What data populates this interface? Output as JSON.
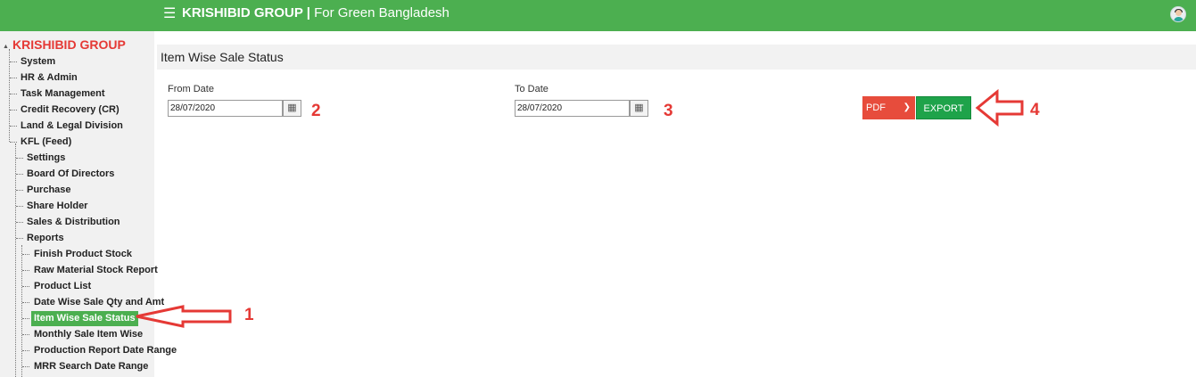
{
  "header": {
    "brand": "KRISHIBID GROUP",
    "separator": " | ",
    "tagline": "For Green Bangladesh"
  },
  "sidebar": {
    "root": "KRISHIBID GROUP",
    "items": [
      "System",
      "HR & Admin",
      "Task Management",
      "Credit Recovery (CR)",
      "Land & Legal Division",
      "KFL (Feed)",
      "Settings",
      "Board Of Directors",
      "Purchase",
      "Share Holder",
      "Sales & Distribution",
      "Reports",
      "Finish Product Stock",
      "Raw Material Stock Report",
      "Product List",
      "Date Wise Sale Qty and Amt",
      "Item Wise Sale Status",
      "Monthly Sale Item Wise",
      "Production Report Date Range",
      "MRR Search Date Range"
    ]
  },
  "page": {
    "title": "Item Wise Sale Status",
    "from_label": "From Date",
    "from_value": "28/07/2020",
    "to_label": "To Date",
    "to_value": "28/07/2020",
    "format_value": "PDF",
    "export_label": "EXPORT"
  },
  "annotations": {
    "a1": "1",
    "a2": "2",
    "a3": "3",
    "a4": "4"
  },
  "colors": {
    "topbar": "#4caf50",
    "brand_red": "#e53935",
    "pdf": "#e74c3c",
    "export": "#1ea34a",
    "active": "#4caf50"
  }
}
